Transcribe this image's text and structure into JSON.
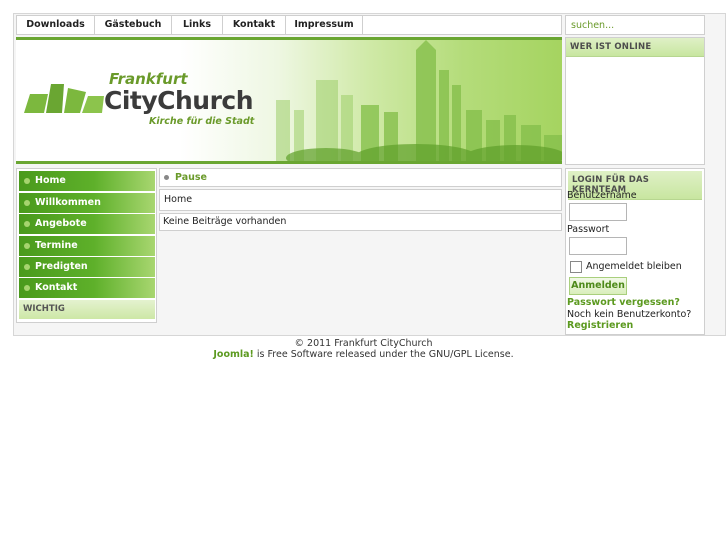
{
  "topnav": {
    "items": [
      "Downloads",
      "Gästebuch",
      "Links",
      "Kontakt",
      "Impressum"
    ]
  },
  "search": {
    "placeholder": "suchen..."
  },
  "header": {
    "logo_line1": "Frankfurt",
    "logo_line2": "CityChurch",
    "logo_tagline": "Kirche für die Stadt"
  },
  "online_panel": {
    "title": "WER IST ONLINE"
  },
  "menu": {
    "items": [
      "Home",
      "Willkommen",
      "Angebote",
      "Termine",
      "Predigten",
      "Kontakt"
    ],
    "section": "WICHTIG"
  },
  "main": {
    "category": "Pause",
    "breadcrumb": "Home",
    "empty_message": "Keine Beiträge vorhanden"
  },
  "login": {
    "title": "LOGIN FÜR DAS KERNTEAM",
    "username_label": "Benutzername",
    "password_label": "Passwort",
    "remember_label": "Angemeldet bleiben",
    "submit_label": "Anmelden",
    "forgot_link": "Passwort vergessen?",
    "no_account_text": "Noch kein Benutzerkonto?",
    "register_link": "Registrieren"
  },
  "footer": {
    "copyright": "© 2011 Frankfurt CityChurch",
    "joomla": "Joomla!",
    "license": " is Free Software released under the GNU/GPL License."
  },
  "colors": {
    "accent_green": "#6aa632",
    "menu_green": "#4a9a1c",
    "link_green": "#5c9a20"
  }
}
